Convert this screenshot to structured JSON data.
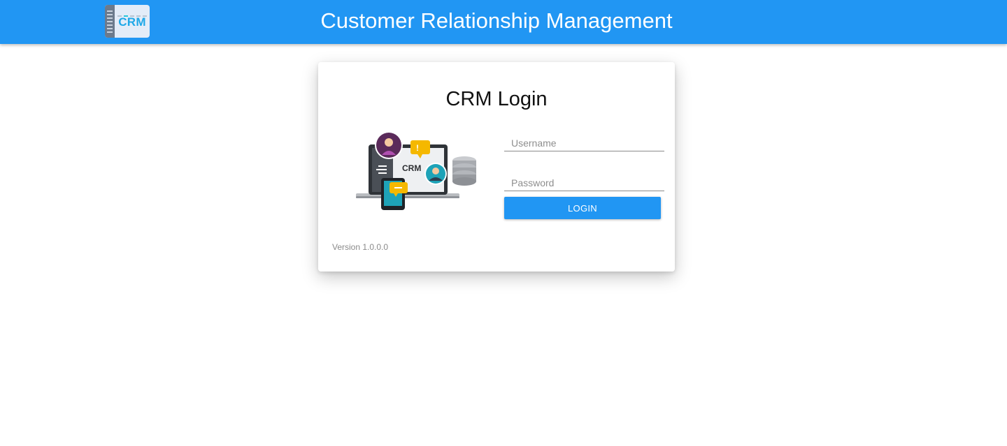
{
  "header": {
    "logo_text": "CRM",
    "title": "Customer Relationship Management",
    "background_color": "#2196f3"
  },
  "login": {
    "title": "CRM Login",
    "illustration_text": "CRM",
    "username": {
      "placeholder": "Username",
      "value": ""
    },
    "password": {
      "placeholder": "Password",
      "value": ""
    },
    "login_button_label": "LOGIN",
    "version": "Version 1.0.0.0"
  },
  "icons": {
    "logo": "crm-logo-icon",
    "illustration": "crm-illustration"
  }
}
